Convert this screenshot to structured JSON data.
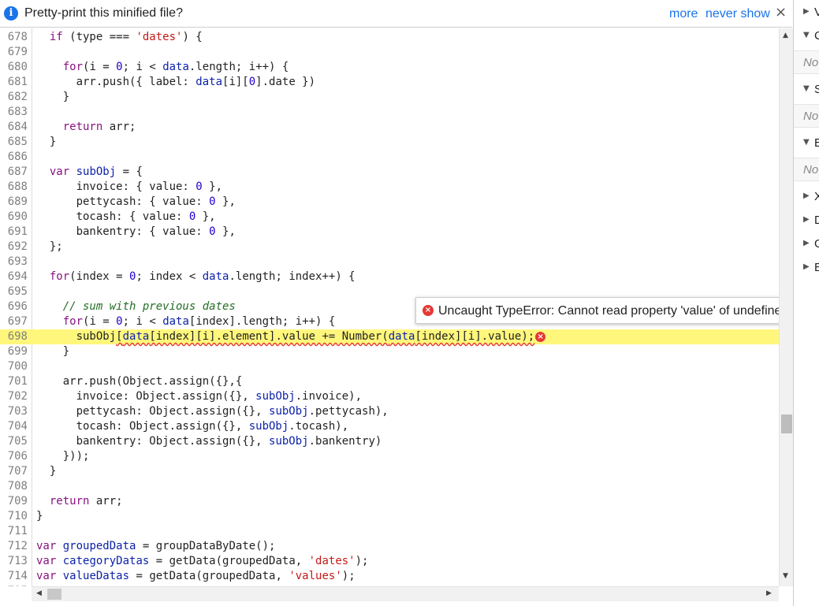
{
  "infobar": {
    "message": "Pretty-print this minified file?",
    "more": "more",
    "never_show": "never show",
    "close_symbol": "×"
  },
  "error": {
    "message": "Uncaught TypeError: Cannot read property 'value' of undefined",
    "line_number": "698"
  },
  "side_panel": {
    "rows": [
      {
        "arrow": "▶",
        "label": "V"
      },
      {
        "arrow": "▼",
        "label": "C"
      },
      {
        "note": "No"
      },
      {
        "arrow": "▼",
        "label": "S"
      },
      {
        "note": "No"
      },
      {
        "arrow": "▼",
        "label": "B"
      },
      {
        "note": "No"
      },
      {
        "arrow": "▶",
        "label": "X"
      },
      {
        "arrow": "▶",
        "label": "D"
      },
      {
        "arrow": "▶",
        "label": "G"
      },
      {
        "arrow": "▶",
        "label": "E"
      }
    ]
  },
  "code_lines": [
    {
      "n": "678",
      "html": "  <span class=\"k\">if</span> (type === <span class=\"s\">'dates'</span>) {"
    },
    {
      "n": "679",
      "html": ""
    },
    {
      "n": "680",
      "html": "    <span class=\"k\">for</span>(i = <span class=\"n\">0</span>; i &lt; <span class=\"v\">data</span>.length; i++) {"
    },
    {
      "n": "681",
      "html": "      arr.push({ label: <span class=\"v\">data</span>[i][<span class=\"n\">0</span>].date })"
    },
    {
      "n": "682",
      "html": "    }"
    },
    {
      "n": "683",
      "html": ""
    },
    {
      "n": "684",
      "html": "    <span class=\"k\">return</span> arr;"
    },
    {
      "n": "685",
      "html": "  }"
    },
    {
      "n": "686",
      "html": ""
    },
    {
      "n": "687",
      "html": "  <span class=\"k\">var</span> <span class=\"v\">subObj</span> = {"
    },
    {
      "n": "688",
      "html": "      invoice: { value: <span class=\"n\">0</span> },"
    },
    {
      "n": "689",
      "html": "      pettycash: { value: <span class=\"n\">0</span> },"
    },
    {
      "n": "690",
      "html": "      tocash: { value: <span class=\"n\">0</span> },"
    },
    {
      "n": "691",
      "html": "      bankentry: { value: <span class=\"n\">0</span> },"
    },
    {
      "n": "692",
      "html": "  };"
    },
    {
      "n": "693",
      "html": ""
    },
    {
      "n": "694",
      "html": "  <span class=\"k\">for</span>(index = <span class=\"n\">0</span>; index &lt; <span class=\"v\">data</span>.length; index++) {"
    },
    {
      "n": "695",
      "html": ""
    },
    {
      "n": "696",
      "html": "    <span class=\"c\">// sum with previous dates</span>"
    },
    {
      "n": "697",
      "html": "    <span class=\"k\">for</span>(i = <span class=\"n\">0</span>; i &lt; <span class=\"v\">data</span>[index].length; i++) {"
    },
    {
      "n": "698",
      "err": true,
      "html": "      subObj<span class=\"squig\">[<span class=\"v\">data</span>[index][i].element].value += Number(<span class=\"v\">data</span>[index][i].value);</span><span class=\"err-dot\">×</span>"
    },
    {
      "n": "699",
      "html": "    }"
    },
    {
      "n": "700",
      "html": ""
    },
    {
      "n": "701",
      "html": "    arr.push(Object.assign({},{"
    },
    {
      "n": "702",
      "html": "      invoice: Object.assign({}, <span class=\"v\">subObj</span>.invoice),"
    },
    {
      "n": "703",
      "html": "      pettycash: Object.assign({}, <span class=\"v\">subObj</span>.pettycash),"
    },
    {
      "n": "704",
      "html": "      tocash: Object.assign({}, <span class=\"v\">subObj</span>.tocash),"
    },
    {
      "n": "705",
      "html": "      bankentry: Object.assign({}, <span class=\"v\">subObj</span>.bankentry)"
    },
    {
      "n": "706",
      "html": "    }));"
    },
    {
      "n": "707",
      "html": "  }"
    },
    {
      "n": "708",
      "html": ""
    },
    {
      "n": "709",
      "html": "  <span class=\"k\">return</span> arr;"
    },
    {
      "n": "710",
      "html": "}"
    },
    {
      "n": "711",
      "html": ""
    },
    {
      "n": "712",
      "html": "<span class=\"k\">var</span> <span class=\"v\">groupedData</span> = groupDataByDate();"
    },
    {
      "n": "713",
      "html": "<span class=\"k\">var</span> <span class=\"v\">categoryDatas</span> = getData(groupedData, <span class=\"s\">'dates'</span>);"
    },
    {
      "n": "714",
      "html": "<span class=\"k\">var</span> <span class=\"v\">valueDatas</span> = getData(groupedData, <span class=\"s\">'values'</span>);"
    },
    {
      "n": "715",
      "html": ""
    }
  ]
}
